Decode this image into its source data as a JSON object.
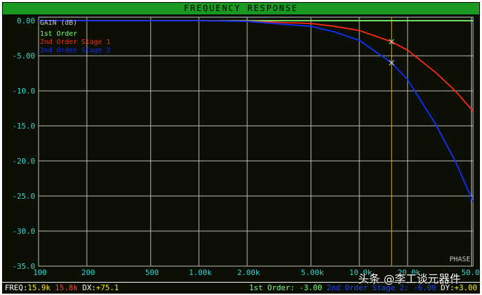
{
  "window": {
    "title": "FREQUENCY RESPONSE"
  },
  "chart_data": {
    "type": "line",
    "title": "FREQUENCY RESPONSE",
    "ylabel": "GAIN (dB)",
    "xlabel": "",
    "x_scale": "log",
    "xlim": [
      100,
      51200
    ],
    "ylim": [
      -35,
      0.5
    ],
    "y_ticks": [
      0,
      -5,
      -10,
      -15,
      -20,
      -25,
      -30,
      -35
    ],
    "y_tick_labels": [
      "0.00",
      "-5.00",
      "-10.0",
      "-15.0",
      "-20.0",
      "-25.0",
      "-30.0",
      "-35.0"
    ],
    "x_ticks": [
      100,
      200,
      500,
      1000,
      2000,
      5000,
      10000,
      20000,
      50000
    ],
    "x_tick_labels": [
      "100",
      "200",
      "500",
      "1.00k",
      "2.00k",
      "5.00k",
      "10.0k",
      "20.0k",
      "50.0k"
    ],
    "grid": true,
    "legend_position": "top-left",
    "cursor_x": 15900,
    "corner_label": "PHASE",
    "series": [
      {
        "name": "1st Order",
        "color": "#7cff7c",
        "x": [
          100,
          1000,
          5000,
          10000,
          15900,
          20000,
          30000,
          51200
        ],
        "y": [
          0,
          0,
          0,
          0,
          0,
          0,
          0,
          0
        ]
      },
      {
        "name": "2nd Order Stage 1",
        "color": "#ff2a10",
        "x": [
          100,
          200,
          500,
          1000,
          2000,
          5000,
          7000,
          10000,
          15900,
          20000,
          30000,
          40000,
          51200
        ],
        "y": [
          0,
          0,
          0,
          0,
          -0.07,
          -0.4,
          -0.8,
          -1.4,
          -3.0,
          -4.2,
          -7.4,
          -10.1,
          -12.9
        ]
      },
      {
        "name": "2nd Order Stage 2",
        "color": "#1030ff",
        "x": [
          100,
          200,
          500,
          1000,
          2000,
          5000,
          7000,
          10000,
          15900,
          20000,
          30000,
          40000,
          51200
        ],
        "y": [
          0,
          0,
          0,
          0,
          -0.1,
          -0.8,
          -1.6,
          -2.8,
          -6.0,
          -8.4,
          -14.8,
          -20.2,
          -25.8
        ]
      }
    ],
    "markers": [
      {
        "x": 15900,
        "y": -3.0,
        "series": "2nd Order Stage 1"
      },
      {
        "x": 15900,
        "y": -6.0,
        "series": "2nd Order Stage 2"
      }
    ]
  },
  "status": {
    "freq_label": "FREQ:",
    "freq_value": "15.9k",
    "freq_value2": "15.8k",
    "dx_label": "DX:",
    "dx_value": "+75.1",
    "first_order": "1st Order: -3.00",
    "second_order": "2nd Order Stage 2: -6.00",
    "dy_label": "DY:",
    "dy_value": "+3.00",
    "colors": {
      "label": "#ffffff",
      "value": "#ffee00",
      "value2": "#ff4040",
      "first": "#7cff7c",
      "second": "#2040ff"
    }
  },
  "watermark": "头条 @李工谈元器件"
}
